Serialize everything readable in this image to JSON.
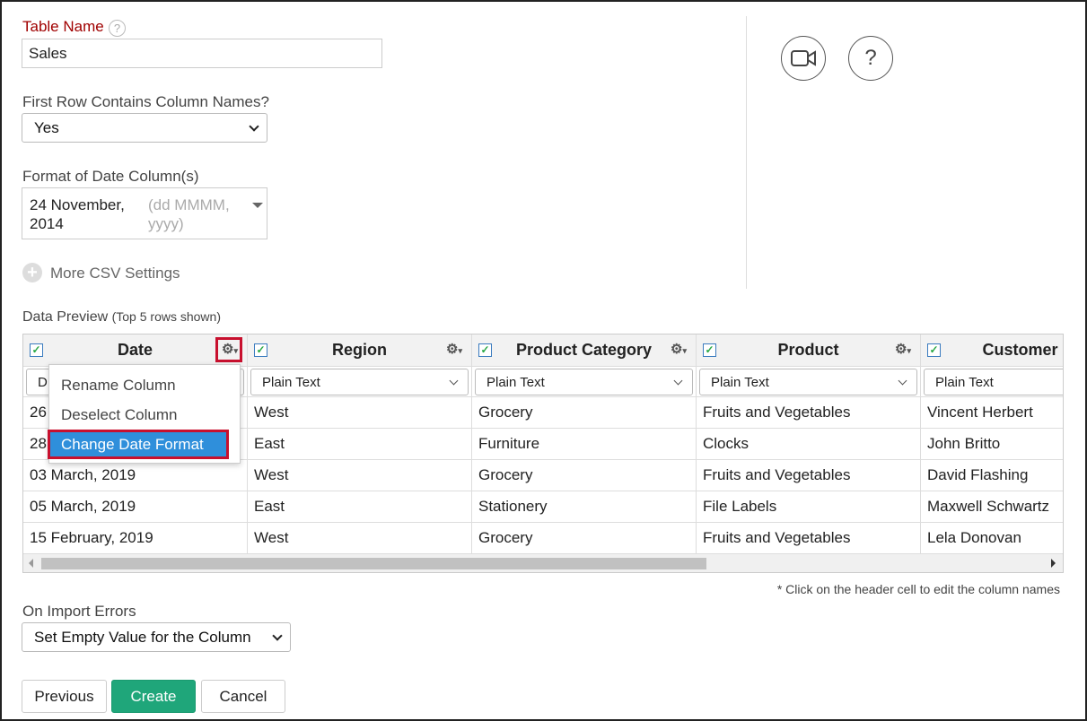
{
  "form": {
    "table_name_label": "Table Name",
    "table_name_value": "Sales",
    "first_row_label": "First Row Contains Column Names?",
    "first_row_value": "Yes",
    "date_format_label": "Format of Date Column(s)",
    "date_format_value_line1": "24 November,",
    "date_format_value_line2": "2014",
    "date_format_hint_line1": "(dd MMMM,",
    "date_format_hint_line2": "yyyy)",
    "more_settings": "More CSV Settings",
    "help_char": "?"
  },
  "preview": {
    "title": "Data Preview",
    "subtitle": "(Top 5 rows shown)",
    "columns": [
      {
        "name": "Date",
        "type": "D"
      },
      {
        "name": "Region",
        "type": "Plain Text"
      },
      {
        "name": "Product Category",
        "type": "Plain Text"
      },
      {
        "name": "Product",
        "type": "Plain Text"
      },
      {
        "name": "Customer Na",
        "type": "Plain Text"
      }
    ],
    "rows": [
      [
        "26",
        "West",
        "Grocery",
        "Fruits and Vegetables",
        "Vincent Herbert"
      ],
      [
        "28",
        "East",
        "Furniture",
        "Clocks",
        "John Britto"
      ],
      [
        "03 March, 2019",
        "West",
        "Grocery",
        "Fruits and Vegetables",
        "David Flashing"
      ],
      [
        "05 March, 2019",
        "East",
        "Stationery",
        "File Labels",
        "Maxwell Schwartz"
      ],
      [
        "15 February, 2019",
        "West",
        "Grocery",
        "Fruits and Vegetables",
        "Lela Donovan"
      ]
    ],
    "note": "* Click on the header cell to edit the column names"
  },
  "menu": {
    "items": [
      "Rename Column",
      "Deselect Column",
      "Change Date Format"
    ]
  },
  "errors": {
    "label": "On Import Errors",
    "value": "Set Empty Value for the Column"
  },
  "buttons": {
    "previous": "Previous",
    "create": "Create",
    "cancel": "Cancel"
  },
  "colors": {
    "accent": "#2f8fdb",
    "create": "#1fa67a",
    "label_red": "#a00000",
    "highlight": "#c8102e"
  }
}
